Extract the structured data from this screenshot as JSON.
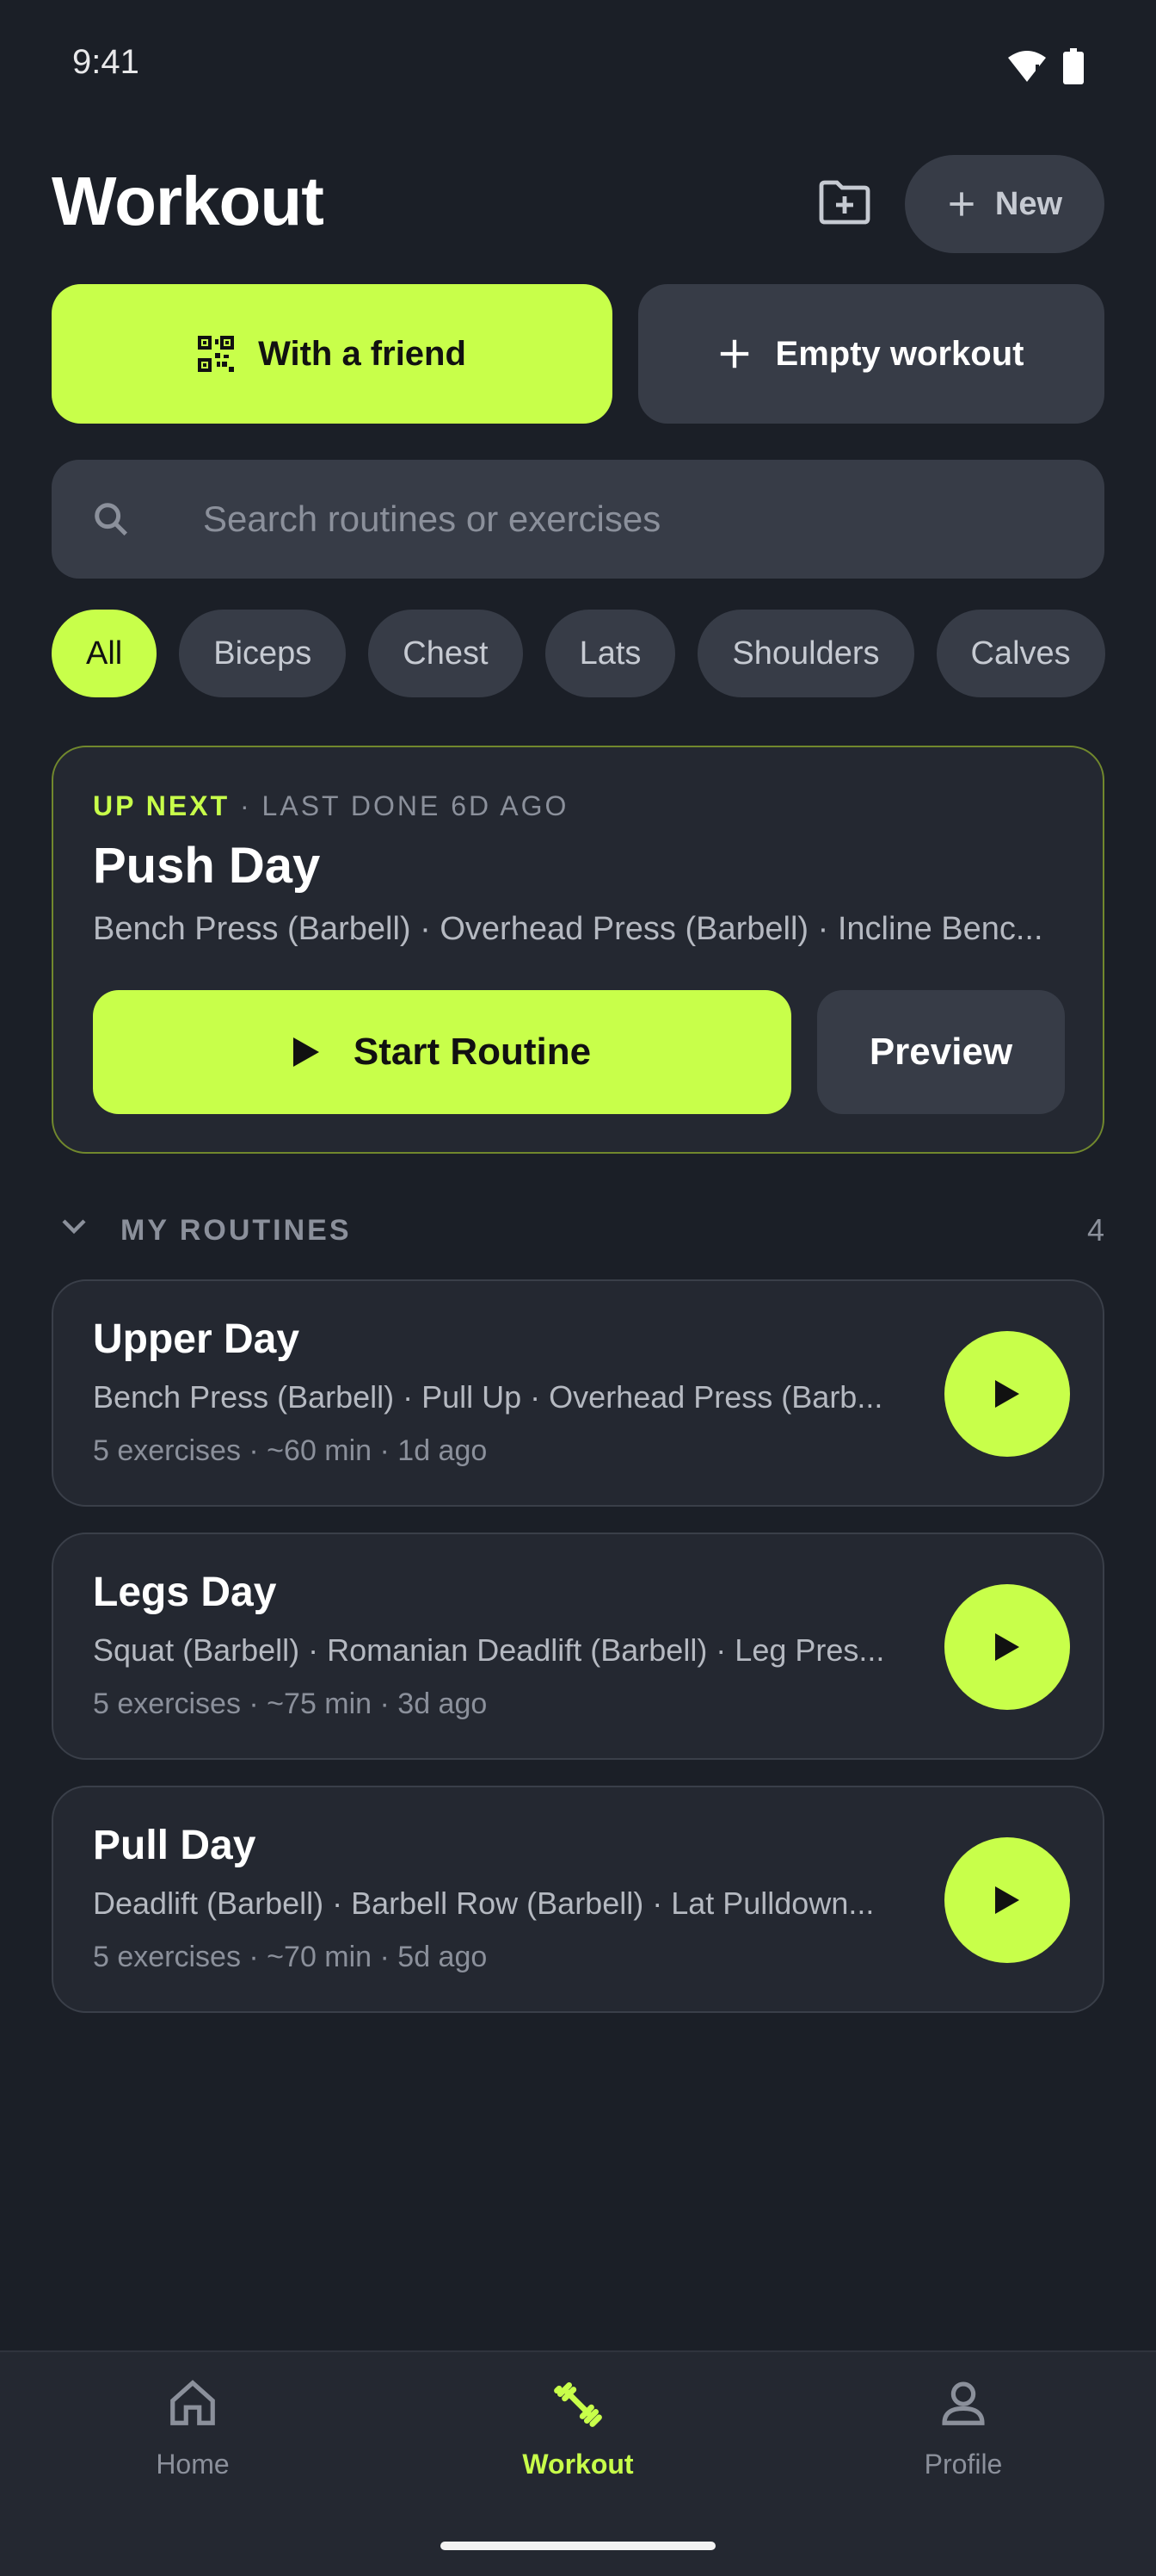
{
  "status_bar": {
    "time": "9:41"
  },
  "header": {
    "title": "Workout",
    "new_label": "New"
  },
  "actions": {
    "friend_label": "With a friend",
    "empty_label": "Empty workout"
  },
  "search": {
    "placeholder": "Search routines or exercises"
  },
  "filters": {
    "items": [
      "All",
      "Biceps",
      "Chest",
      "Lats",
      "Shoulders",
      "Calves"
    ],
    "selected": "All"
  },
  "up_next": {
    "tag": "UP NEXT",
    "separator": " · ",
    "last_done": "LAST DONE 6D AGO",
    "title": "Push Day",
    "exercises": "Bench Press (Barbell) · Overhead Press (Barbell) · Incline Benc...",
    "start_label": "Start Routine",
    "preview_label": "Preview"
  },
  "my_routines": {
    "title": "MY ROUTINES",
    "count": "4",
    "items": [
      {
        "title": "Upper Day",
        "exercises": "Bench Press (Barbell) · Pull Up · Overhead Press (Barb...",
        "meta": "5 exercises · ~60 min · 1d ago"
      },
      {
        "title": "Legs Day",
        "exercises": "Squat (Barbell) · Romanian Deadlift (Barbell) · Leg Pres...",
        "meta": "5 exercises · ~75 min · 3d ago"
      },
      {
        "title": "Pull Day",
        "exercises": "Deadlift (Barbell) · Barbell Row (Barbell) · Lat Pulldown...",
        "meta": "5 exercises · ~70 min · 5d ago"
      }
    ]
  },
  "bottom_nav": {
    "items": [
      {
        "label": "Home",
        "icon": "home-icon"
      },
      {
        "label": "Workout",
        "icon": "dumbbell-icon"
      },
      {
        "label": "Profile",
        "icon": "person-icon"
      }
    ],
    "active": "Workout"
  },
  "colors": {
    "accent": "#c8ff4a",
    "background": "#1b1f27",
    "surface": "#242831",
    "chip": "#373c47"
  }
}
